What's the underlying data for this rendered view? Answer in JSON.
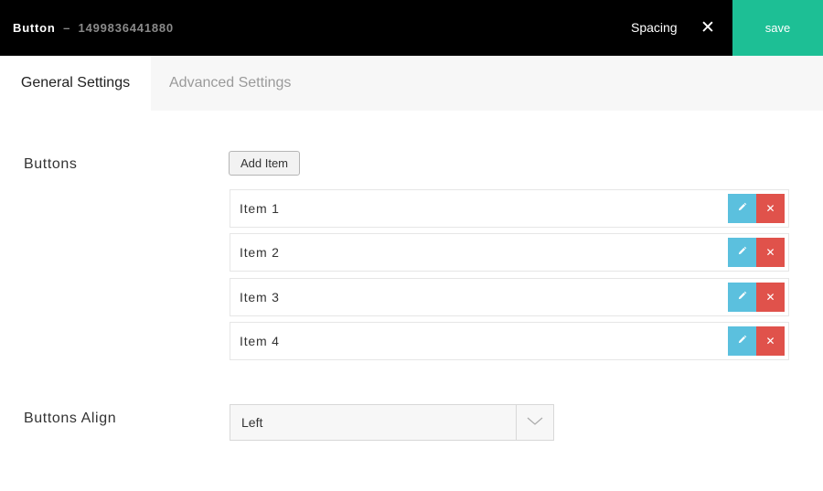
{
  "header": {
    "title": "Button",
    "separator": "–",
    "element_id": "1499836441880",
    "spacing_label": "Spacing",
    "close_glyph": "✕",
    "save_label": "save",
    "background_color": "#000000",
    "save_color": "#1dbf95"
  },
  "tabs": [
    {
      "label": "General Settings",
      "active": true
    },
    {
      "label": "Advanced Settings",
      "active": false
    }
  ],
  "buttons_field": {
    "label": "Buttons",
    "add_label": "Add Item",
    "items": [
      {
        "label": "Item 1"
      },
      {
        "label": "Item 2"
      },
      {
        "label": "Item 3"
      },
      {
        "label": "Item 4"
      }
    ],
    "edit_icon": "pencil-icon",
    "delete_icon": "close-icon",
    "delete_glyph": "✕",
    "edit_color": "#5bc0de",
    "delete_color": "#e0524b"
  },
  "align_field": {
    "label": "Buttons Align",
    "value": "Left",
    "arrow_icon": "chevron-down-icon"
  }
}
